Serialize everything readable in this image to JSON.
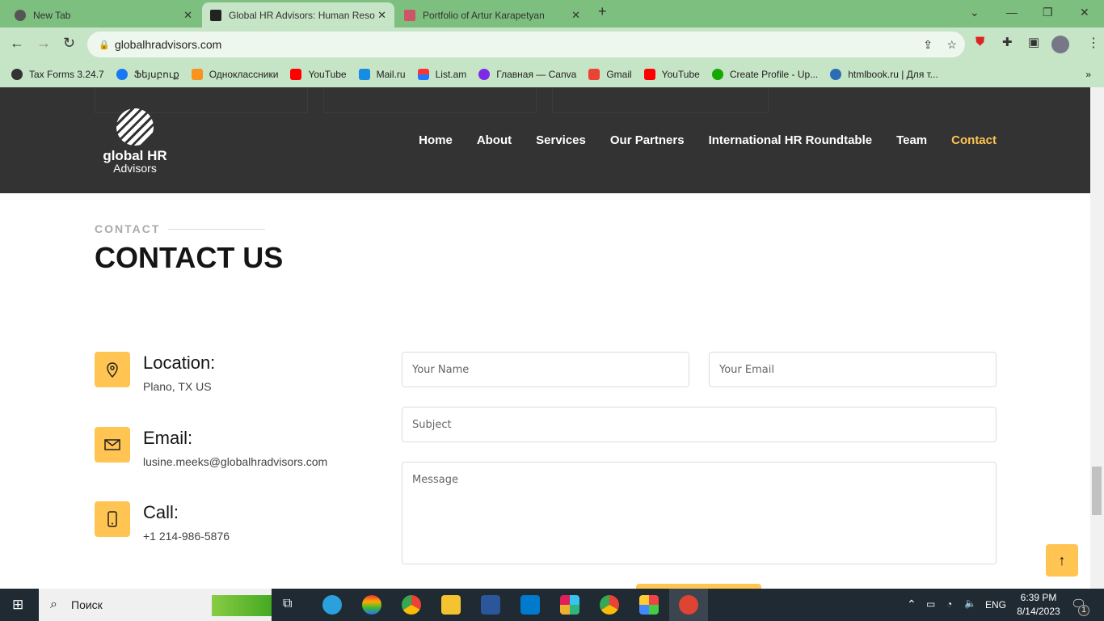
{
  "browser": {
    "tabs": [
      {
        "label": "New Tab"
      },
      {
        "label": "Global HR Advisors: Human Reso"
      },
      {
        "label": "Portfolio of Artur Karapetyan"
      }
    ],
    "url": "globalhradvisors.com",
    "bookmarks": [
      "Tax Forms 3.24.7",
      "Ֆեյսբուք",
      "Одноклассники",
      "YouTube",
      "Mail.ru",
      "List.am",
      "Главная — Canva",
      "Gmail",
      "YouTube",
      "Create Profile - Up...",
      "htmlbook.ru | Для т..."
    ],
    "bookmark_colors": [
      "#333",
      "#1877f2",
      "#f7931e",
      "#f00",
      "#168de2",
      "#f44",
      "#7d2ae8",
      "#ea4335",
      "#f00",
      "#14a800",
      "#2a6db5"
    ]
  },
  "site": {
    "logo": {
      "line1": "global HR",
      "line2": "Advisors"
    },
    "menu": [
      "Home",
      "About",
      "Services",
      "Our Partners",
      "International HR Roundtable",
      "Team",
      "Contact"
    ],
    "active_menu": "Contact",
    "accent": "#ffc451",
    "section_label": "CONTACT",
    "section_title": "CONTACT US",
    "info": [
      {
        "icon": "map-pin-icon",
        "title": "Location:",
        "value": "Plano, TX US"
      },
      {
        "icon": "envelope-icon",
        "title": "Email:",
        "value": "lusine.meeks@globalhradvisors.com"
      },
      {
        "icon": "phone-icon",
        "title": "Call:",
        "value": "+1 214-986-5876"
      }
    ],
    "form": {
      "name_placeholder": "Your Name",
      "email_placeholder": "Your Email",
      "subject_placeholder": "Subject",
      "message_placeholder": "Message"
    }
  },
  "taskbar": {
    "search": "Поиск",
    "lang": "ENG",
    "time": "6:39 PM",
    "date": "8/14/2023",
    "notifications": "1"
  }
}
